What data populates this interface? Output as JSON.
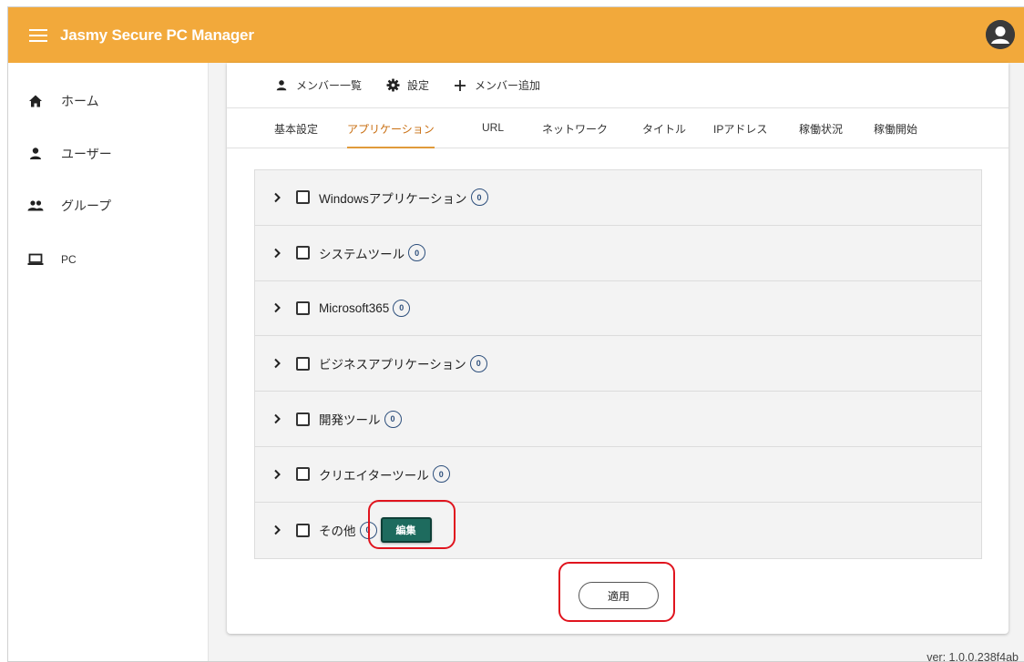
{
  "app": {
    "title": "Jasmy Secure PC Manager",
    "version": "ver: 1.0.0.238f4ab"
  },
  "sidebar": {
    "items": [
      {
        "label": "ホーム",
        "icon": "home-icon"
      },
      {
        "label": "ユーザー",
        "icon": "person-icon"
      },
      {
        "label": "グループ",
        "icon": "group-icon"
      },
      {
        "label": "PC",
        "icon": "laptop-icon"
      }
    ]
  },
  "top_tabs": [
    {
      "label": "メンバー一覧",
      "icon": "person-icon"
    },
    {
      "label": "設定",
      "icon": "gear-icon"
    },
    {
      "label": "メンバー追加",
      "icon": "plus-icon"
    }
  ],
  "sub_tabs": [
    {
      "label": "基本設定"
    },
    {
      "label": "アプリケーション",
      "active": true
    },
    {
      "label": "URL"
    },
    {
      "label": "ネットワーク"
    },
    {
      "label": "タイトル"
    },
    {
      "label": "IPアドレス"
    },
    {
      "label": "稼働状況"
    },
    {
      "label": "稼働開始"
    }
  ],
  "categories": [
    {
      "label": "Windowsアプリケーション",
      "count": "0"
    },
    {
      "label": "システムツール",
      "count": "0"
    },
    {
      "label": "Microsoft365",
      "count": "0"
    },
    {
      "label": "ビジネスアプリケーション",
      "count": "0"
    },
    {
      "label": "開発ツール",
      "count": "0"
    },
    {
      "label": "クリエイターツール",
      "count": "0"
    },
    {
      "label": "その他",
      "count": "0"
    }
  ],
  "buttons": {
    "edit": "編集",
    "apply": "適用"
  },
  "colors": {
    "appbar": "#f2a93b",
    "active_tab": "#c96f12",
    "edit_button": "#1e6b5e",
    "highlight": "#e0141e",
    "count_badge": "#2d4f7c"
  }
}
